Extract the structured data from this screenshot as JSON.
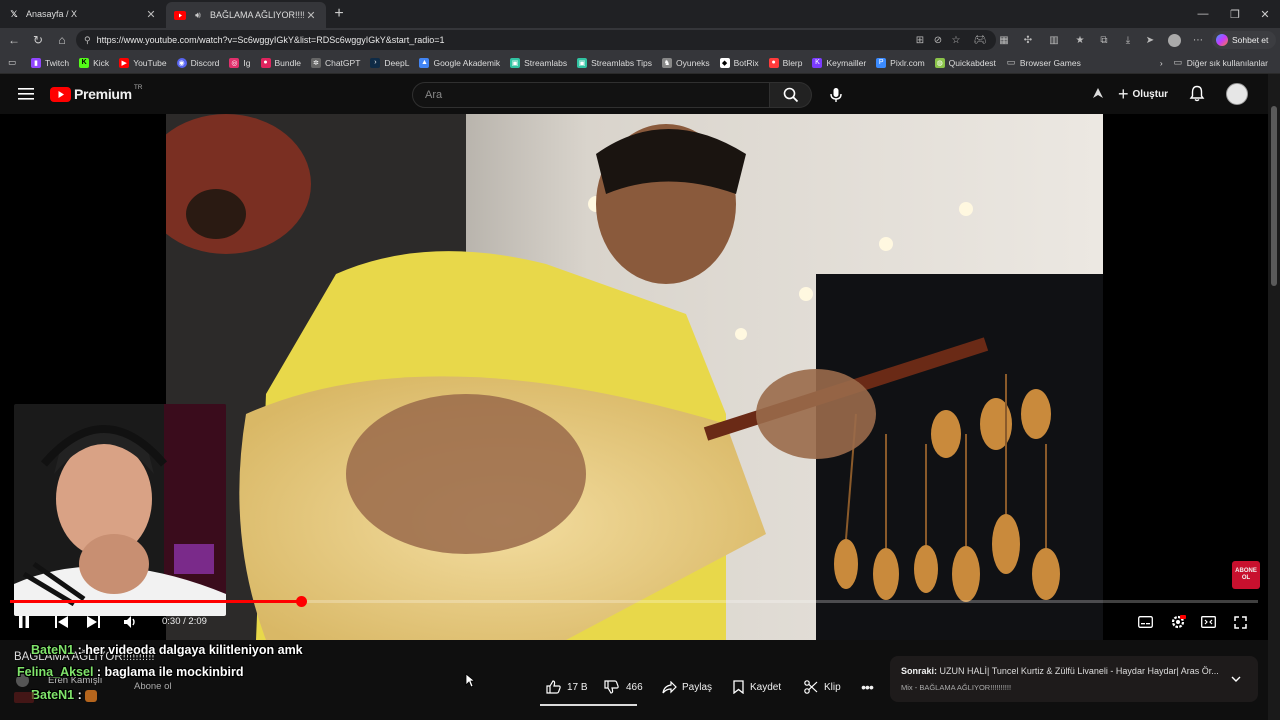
{
  "browser": {
    "tabs": [
      {
        "title": "Anasayfa / X",
        "icon": "x-logo-icon"
      },
      {
        "title": "BAĞLAMA AĞLIYOR!!!!!!!!!! - Y",
        "icon": "youtube-logo-icon",
        "active": true
      }
    ],
    "url": "https://www.youtube.com/watch?v=Sc6wggyIGkY&list=RDSc6wggyIGkY&start_radio=1",
    "copilot_label": "Sohbet et",
    "bookmarks": [
      {
        "label": "Twitch",
        "icon": "twitch-icon",
        "color": "#9146ff"
      },
      {
        "label": "Kick",
        "icon": "kick-icon",
        "color": "#53fc18"
      },
      {
        "label": "YouTube",
        "icon": "youtube-icon",
        "color": "#ff0000"
      },
      {
        "label": "Discord",
        "icon": "discord-icon",
        "color": "#5865f2"
      },
      {
        "label": "Ig",
        "icon": "instagram-icon",
        "color": "#e1306c"
      },
      {
        "label": "Bundle",
        "icon": "bundle-icon",
        "color": "#e0245e"
      },
      {
        "label": "ChatGPT",
        "icon": "chatgpt-icon",
        "color": "#666666"
      },
      {
        "label": "DeepL",
        "icon": "deepl-icon",
        "color": "#0f2b46"
      },
      {
        "label": "Google Akademik",
        "icon": "scholar-icon",
        "color": "#4285f4"
      },
      {
        "label": "Streamlabs",
        "icon": "streamlabs-icon",
        "color": "#31c3a2"
      },
      {
        "label": "Streamlabs Tips",
        "icon": "streamlabs-icon",
        "color": "#31c3a2"
      },
      {
        "label": "Oyuneks",
        "icon": "oyuneks-icon",
        "color": "#888888"
      },
      {
        "label": "BotRix",
        "icon": "botrix-icon",
        "color": "#ffffff"
      },
      {
        "label": "Blerp",
        "icon": "blerp-icon",
        "color": "#ff3b3b"
      },
      {
        "label": "Keymailler",
        "icon": "keymailler-icon",
        "color": "#7b3bff"
      },
      {
        "label": "Pixlr.com",
        "icon": "pixlr-icon",
        "color": "#3b8bff"
      },
      {
        "label": "Quickabdest",
        "icon": "quickabdest-icon",
        "color": "#8bc34a"
      },
      {
        "label": "Browser Games",
        "icon": "folder-icon",
        "color": "#bbbbbb"
      }
    ],
    "other_bookmarks": "Diğer sık kullanılanlar"
  },
  "youtube": {
    "logo": "Premium",
    "region": "TR",
    "search_placeholder": "Ara",
    "create_label": "Oluştur"
  },
  "player": {
    "time": "0:30 / 2:09",
    "progress": 0.233,
    "subscribe_badge": "ABONE OL"
  },
  "video_info": {
    "title_overlay": "BAĞLAMA AĞLIYOR!!!!!!!!!!",
    "channel": "Eren Kamışlı",
    "subscribe": "Abone ol",
    "likes": "17 B",
    "dislikes": "466",
    "share": "Paylaş",
    "save": "Kaydet",
    "clip": "Klip"
  },
  "chat": [
    {
      "user": "BateN1",
      "message": ": her videoda dalgaya kilitleniyon amk"
    },
    {
      "user": "Felina_Aksel",
      "message": ": baglama ile mockinbird"
    },
    {
      "user": "BateN1",
      "message": ":"
    }
  ],
  "next_up": {
    "prefix": "Sonraki:",
    "title": "UZUN HALİ| Tuncel Kurtiz & Zülfü Livaneli - Haydar Haydar| Aras Ör...",
    "mix": "Mix - BAĞLAMA AĞLIYOR!!!!!!!!!!"
  },
  "colors": {
    "accent": "#ff0000",
    "chat_name": "#7fe36a",
    "background": "#0f0f0f"
  }
}
